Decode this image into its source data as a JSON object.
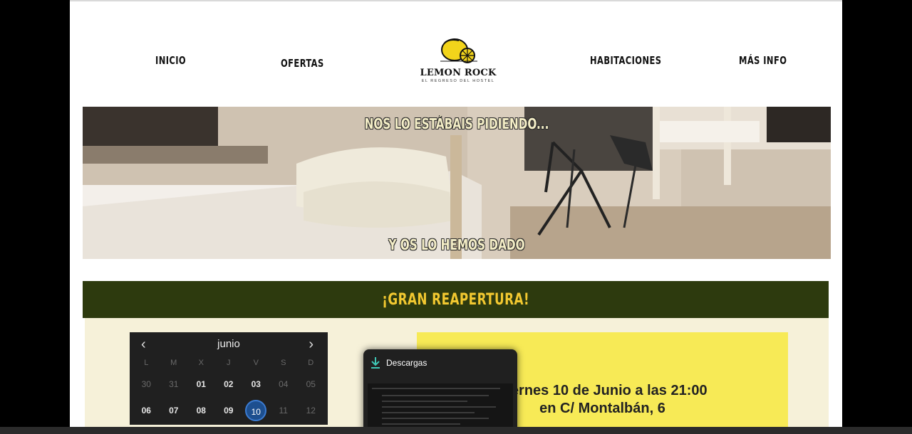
{
  "nav": {
    "inicio": "INICIO",
    "ofertas": "OFERTAS",
    "habitaciones": "HABITACIONES",
    "mas_info": "MÁS INFO"
  },
  "logo": {
    "name": "LEMON ROCK",
    "tagline": "EL REGRESO DEL HOSTEL"
  },
  "hero": {
    "top_text": "NOS LO ESTÁBAIS PIDIENDO...",
    "bottom_text": "Y OS LO HEMOS DADO"
  },
  "banner": {
    "title": "¡GRAN  REAPERTURA!"
  },
  "calendar": {
    "month": "junio",
    "prev_icon": "‹",
    "next_icon": "›",
    "weekdays": [
      "L",
      "M",
      "X",
      "J",
      "V",
      "S",
      "D"
    ],
    "week1": [
      "30",
      "31",
      "01",
      "02",
      "03",
      "04",
      "05"
    ],
    "week2": [
      "06",
      "07",
      "08",
      "09",
      "10",
      "11",
      "12"
    ],
    "selected": "10"
  },
  "event": {
    "line1": "Viernes 10 de Junio a las 21:00",
    "line2": "en C/ Montalbán, 6"
  },
  "downloads": {
    "title": "Descargas"
  },
  "colors": {
    "banner_bg": "#2d3a0e",
    "banner_text": "#f2c830",
    "event_bg": "#f7ea56",
    "cream_bg": "#f6f1d9",
    "calendar_selected": "#1d4f8f"
  }
}
